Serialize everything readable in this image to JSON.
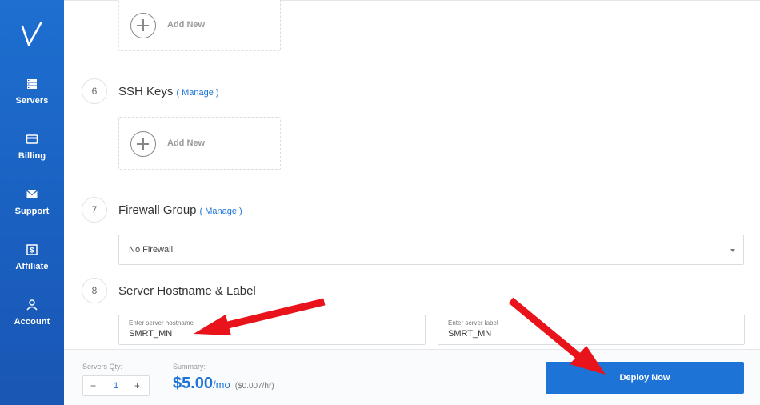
{
  "sidebar": {
    "items": [
      {
        "label": "Servers",
        "icon": "servers-icon"
      },
      {
        "label": "Billing",
        "icon": "credit-card-icon"
      },
      {
        "label": "Support",
        "icon": "envelope-icon"
      },
      {
        "label": "Affiliate",
        "icon": "dollar-icon"
      },
      {
        "label": "Account",
        "icon": "user-icon"
      }
    ]
  },
  "add_new_label": "Add New",
  "steps": [
    {
      "number": "6",
      "title": "SSH Keys",
      "manage": "( Manage )"
    },
    {
      "number": "7",
      "title": "Firewall Group",
      "manage": "( Manage )"
    },
    {
      "number": "8",
      "title": "Server Hostname & Label"
    }
  ],
  "firewall": {
    "selected": "No Firewall"
  },
  "hostname": {
    "label": "Enter server hostname",
    "value": "SMRT_MN"
  },
  "server_label": {
    "label": "Enter server label",
    "value": "SMRT_MN"
  },
  "bottom": {
    "qty_label": "Servers Qty:",
    "qty": "1",
    "minus": "−",
    "plus": "+",
    "summary_label": "Summary:",
    "price": "$5.00",
    "price_unit": "/mo",
    "hourly": "($0.007/hr)",
    "deploy": "Deploy Now"
  },
  "colors": {
    "accent": "#1e74d6",
    "sidebar": "#1a5fbf",
    "annotation_arrow": "#e8131b"
  }
}
